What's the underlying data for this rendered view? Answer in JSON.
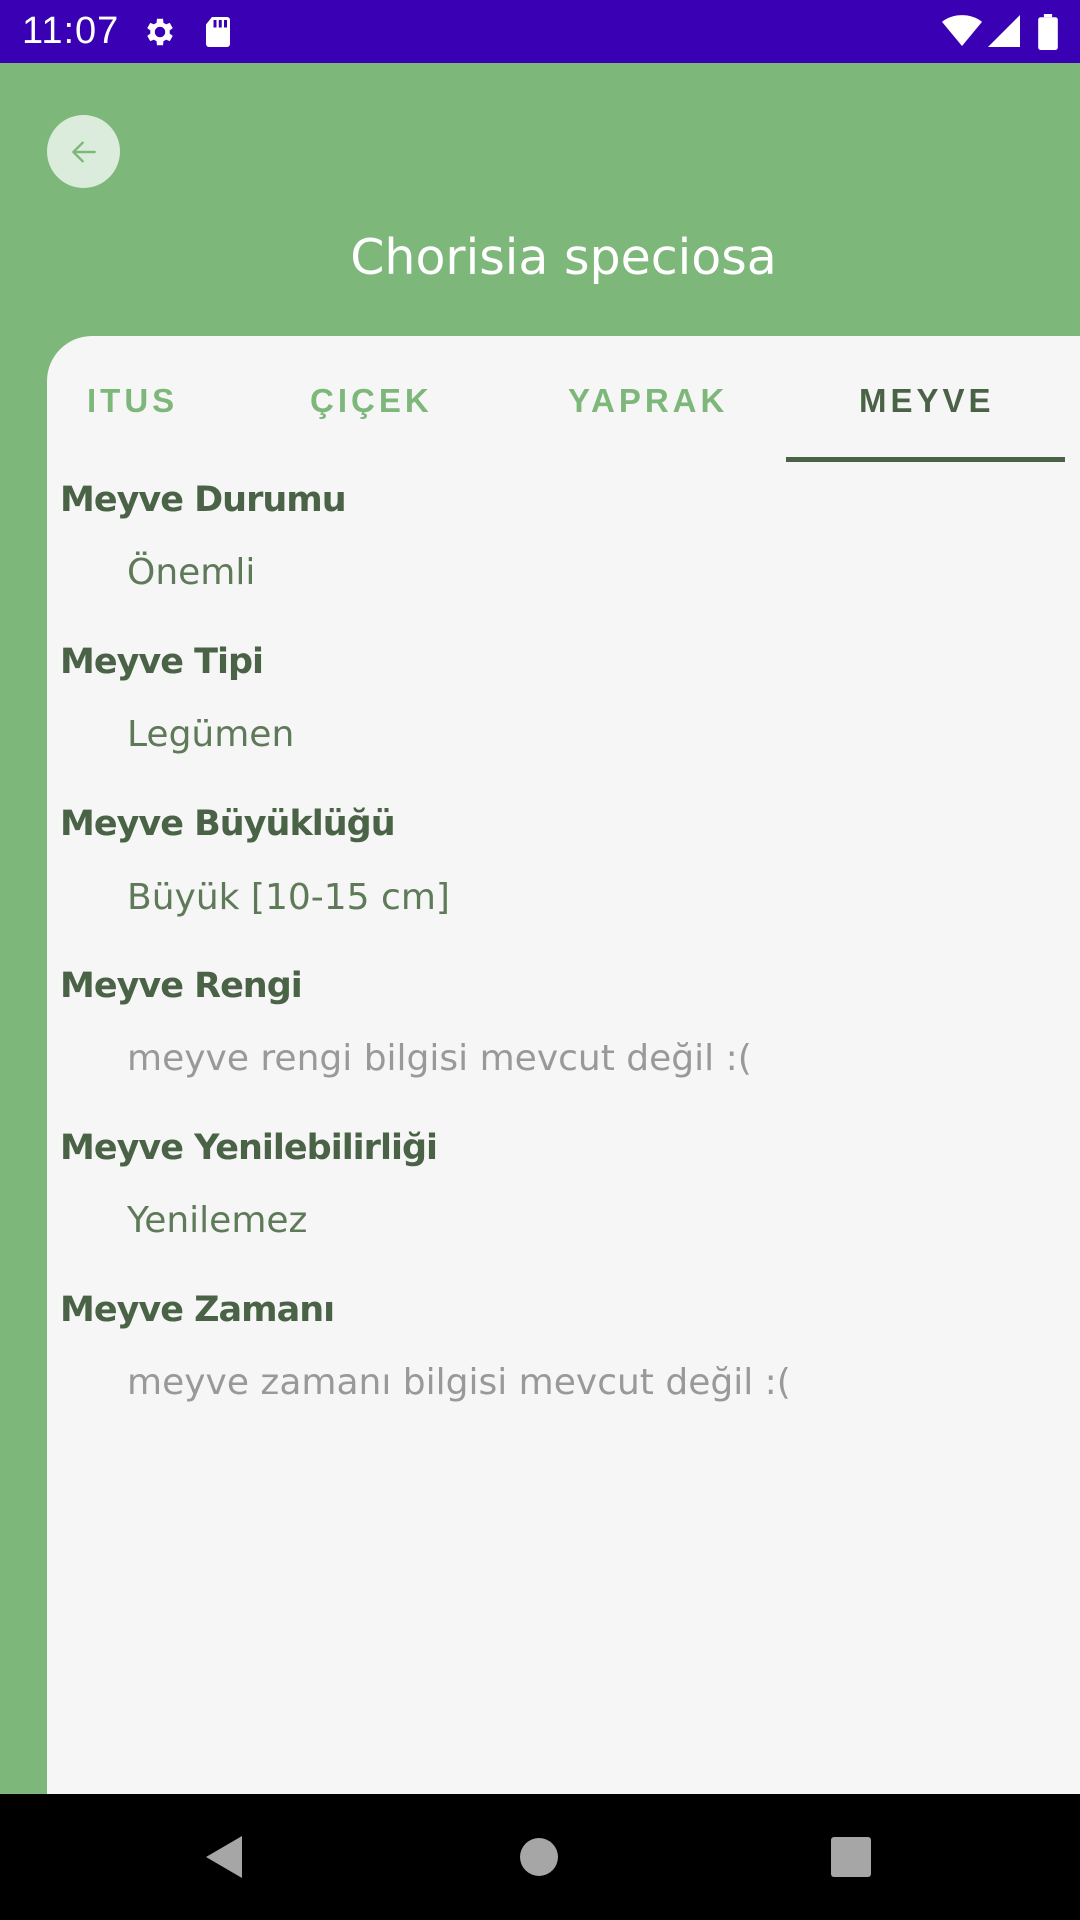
{
  "status_bar": {
    "time": "11:07",
    "icons": [
      "gear-icon",
      "sd-card-icon",
      "wifi-icon",
      "signal-icon",
      "battery-icon"
    ]
  },
  "header": {
    "back_icon": "arrow-left-icon",
    "title": "Chorisia speciosa"
  },
  "tabs": [
    {
      "label": "ITUS",
      "active": false
    },
    {
      "label": "ÇIÇEK",
      "active": false
    },
    {
      "label": "YAPRAK",
      "active": false
    },
    {
      "label": "MEYVE",
      "active": true
    }
  ],
  "fields": [
    {
      "label": "Meyve Durumu",
      "value": "Önemli",
      "missing": false
    },
    {
      "label": "Meyve Tipi",
      "value": "Legümen",
      "missing": false
    },
    {
      "label": "Meyve Büyüklüğü",
      "value": "Büyük [10-15 cm]",
      "missing": false
    },
    {
      "label": "Meyve Rengi",
      "value": "meyve rengi bilgisi mevcut değil :(",
      "missing": true
    },
    {
      "label": "Meyve Yenilebilirliği",
      "value": "Yenilemez",
      "missing": false
    },
    {
      "label": "Meyve Zamanı",
      "value": "meyve zamanı bilgisi mevcut değil :(",
      "missing": true
    }
  ],
  "nav_bar": {
    "icons": [
      "back-triangle-icon",
      "home-circle-icon",
      "recents-square-icon"
    ]
  },
  "colors": {
    "status_bar": "#3a00b4",
    "header_green": "#7db77a",
    "dark_green": "#4a6346",
    "value_green": "#5e7a59",
    "missing_gray": "#999999",
    "card_bg": "#f6f6f6"
  }
}
